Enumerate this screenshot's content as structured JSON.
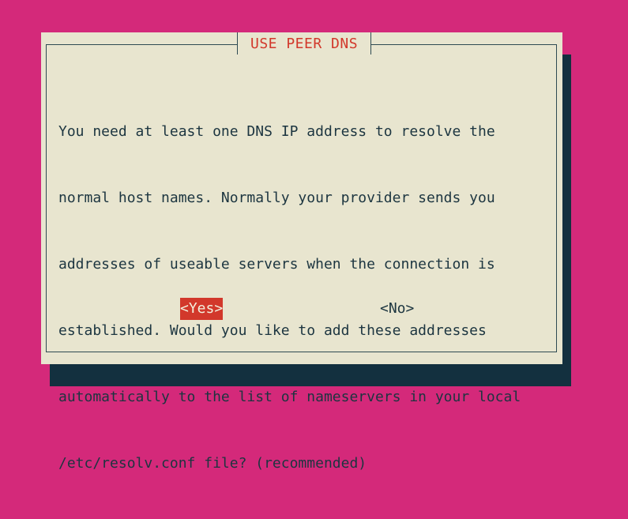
{
  "dialog": {
    "title": "USE PEER DNS",
    "message": [
      "You need at least one DNS IP address to resolve the",
      "normal host names. Normally your provider sends you",
      "addresses of useable servers when the connection is",
      "established. Would you like to add these addresses",
      "automatically to the list of nameservers in your local",
      "/etc/resolv.conf file? (recommended)"
    ],
    "buttons": {
      "yes_label": "<Yes>",
      "no_label": "<No>"
    }
  },
  "colors": {
    "desktop_background": "#d4297a",
    "dialog_background": "#e8e5cf",
    "shadow": "#13303f",
    "title_text": "#d2382b",
    "selected_button_background": "#d2382b",
    "body_text": "#1c3540"
  }
}
